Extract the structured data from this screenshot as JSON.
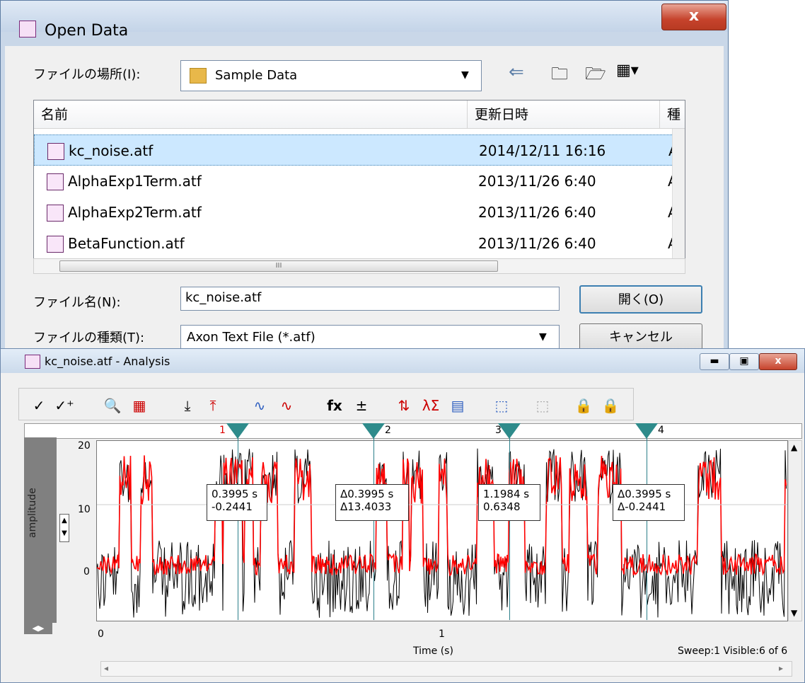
{
  "dialog": {
    "title": "Open Data",
    "close_label": "x",
    "location_label": "ファイルの場所(I):",
    "location_value": "Sample Data",
    "columns": {
      "name": "名前",
      "date": "更新日時",
      "type": "種"
    },
    "files": [
      {
        "name": "kc_noise.atf",
        "date": "2014/12/11 16:16",
        "type": "A"
      },
      {
        "name": "AlphaExp1Term.atf",
        "date": "2013/11/26 6:40",
        "type": "A"
      },
      {
        "name": "AlphaExp2Term.atf",
        "date": "2013/11/26 6:40",
        "type": "A"
      },
      {
        "name": "BetaFunction.atf",
        "date": "2013/11/26 6:40",
        "type": "A"
      }
    ],
    "filename_label": "ファイル名(N):",
    "filename_value": "kc_noise.atf",
    "filetype_label": "ファイルの種類(T):",
    "filetype_value": "Axon Text File (*.atf)",
    "open_label": "開く(O)",
    "cancel_label": "キャンセル",
    "hscroll_mark": "III"
  },
  "analysis": {
    "title": "kc_noise.atf - Analysis",
    "toolbar": [
      "✓",
      "✓⁺",
      "🔍",
      "▦",
      "⤓",
      "⤒",
      "∿",
      "∿",
      "fx",
      "±",
      "⇅",
      "λΣ",
      "▤",
      "⬚",
      "⬚",
      "🔒",
      "🔒"
    ],
    "y_axis_label": "amplitude",
    "x_axis_label": "Time (s)",
    "y_ticks": [
      "20",
      "10",
      "0"
    ],
    "x_ticks": [
      "0",
      "1"
    ],
    "status": "Sweep:1 Visible:6 of 6",
    "cursors": [
      {
        "num": "1",
        "line1": "0.3995 s",
        "line2": "-0.2441"
      },
      {
        "num": "2",
        "line1": "Δ0.3995 s",
        "line2": "Δ13.4033"
      },
      {
        "num": "3",
        "line1": "1.1984 s",
        "line2": "0.6348"
      },
      {
        "num": "4",
        "line1": "Δ0.3995 s",
        "line2": "Δ-0.2441"
      }
    ],
    "colors": {
      "trace_black": "#000000",
      "trace_red": "#ff0000",
      "cursor": "#2e8b8b"
    }
  }
}
